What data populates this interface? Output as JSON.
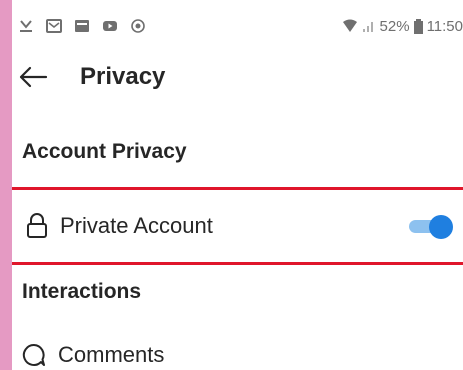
{
  "status_bar": {
    "left_icons": [
      "download-icon",
      "gmail-icon",
      "message-icon",
      "youtube-icon",
      "cast-icon"
    ],
    "battery_percent": "52%",
    "time": "11:50"
  },
  "header": {
    "title": "Privacy"
  },
  "sections": {
    "account_privacy": "Account Privacy",
    "interactions": "Interactions"
  },
  "private_account": {
    "label": "Private Account",
    "enabled": true,
    "highlight_color": "#e0162b",
    "toggle_color": "#1f7fe0"
  },
  "comments": {
    "label": "Comments"
  }
}
